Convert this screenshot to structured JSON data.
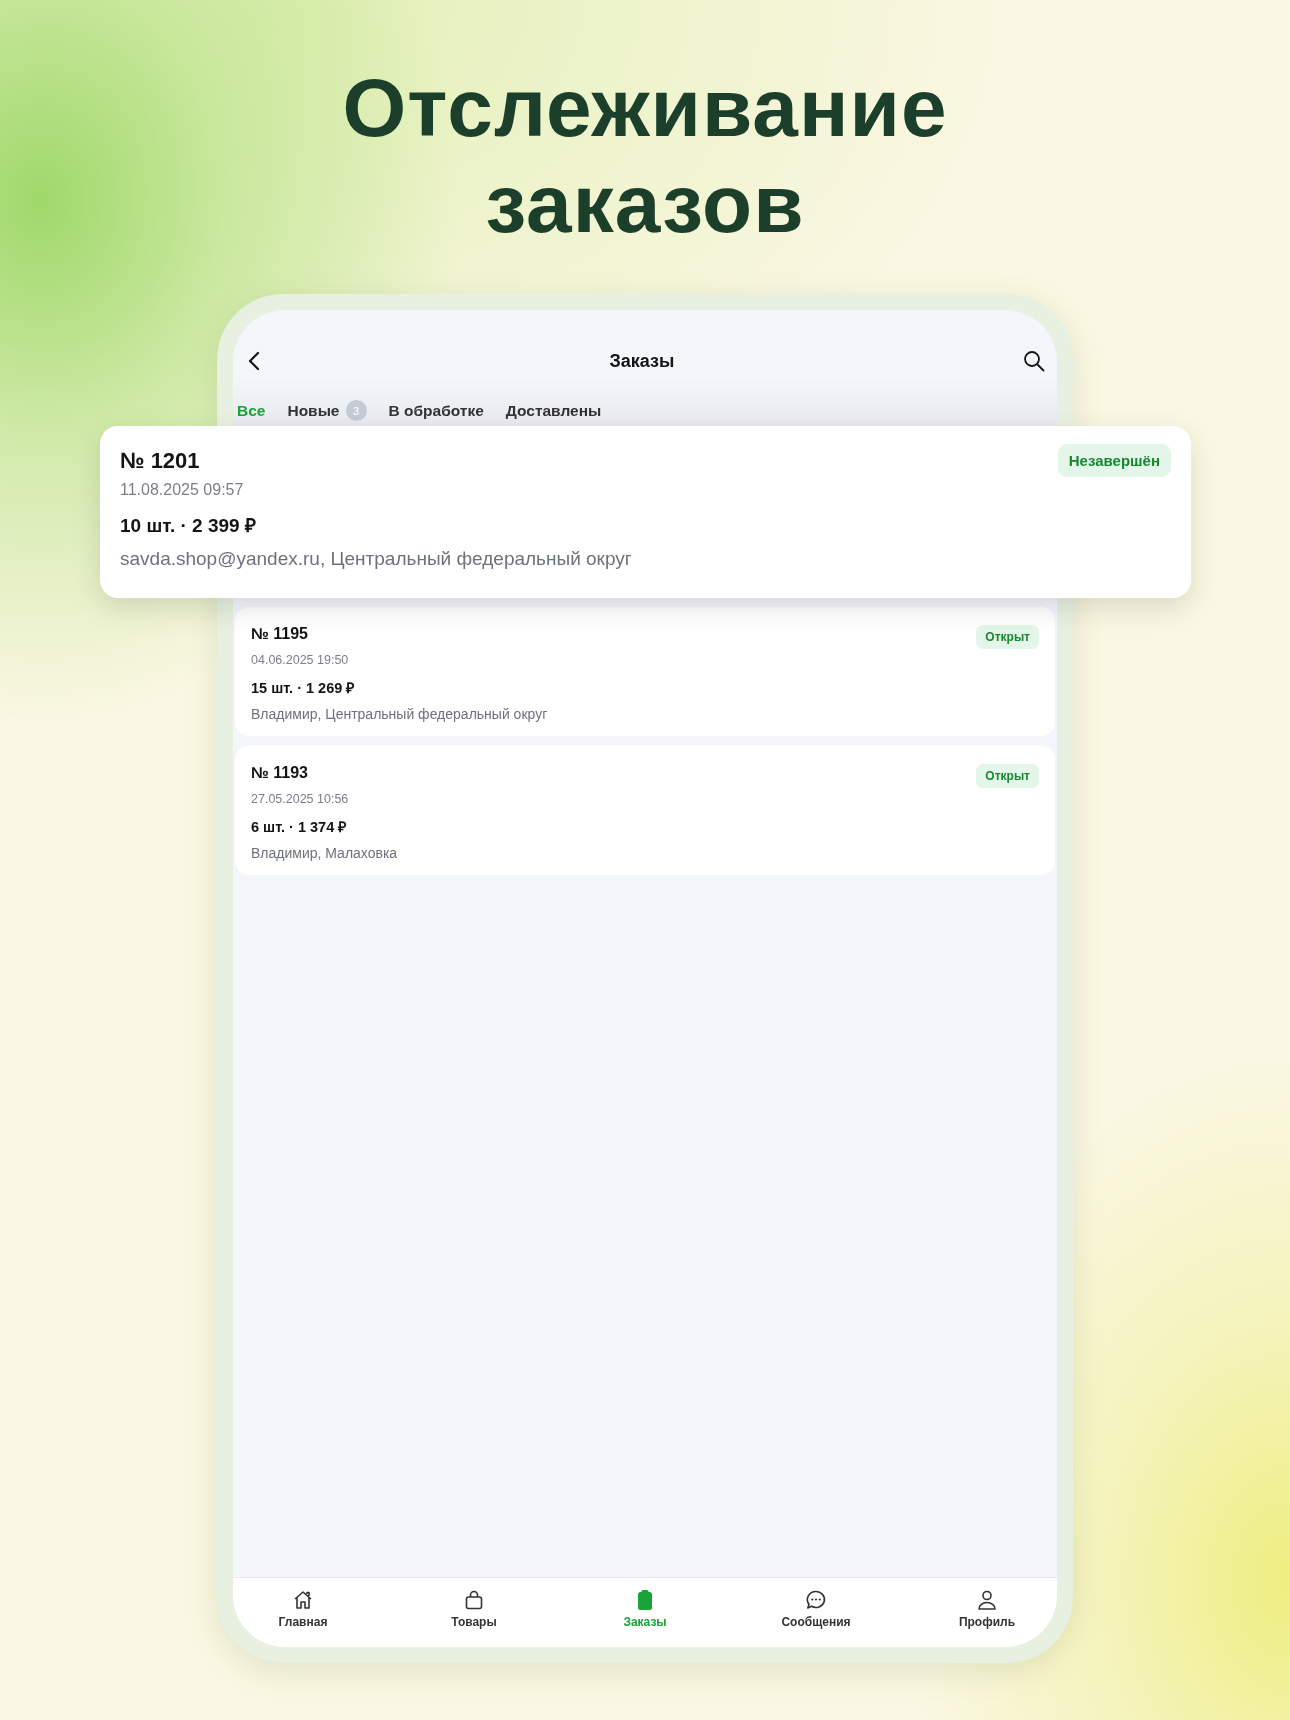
{
  "headline": "Отслеживание заказов",
  "top_bar": {
    "title": "Заказы"
  },
  "tabs": [
    {
      "label": "Все",
      "selected": true
    },
    {
      "label": "Новые",
      "badge": "3",
      "selected": false
    },
    {
      "label": "В обработке",
      "selected": false
    },
    {
      "label": "Доставлены",
      "selected": false
    }
  ],
  "highlighted_order": {
    "number": "№ 1201",
    "status": "Незавершён",
    "date": "11.08.2025 09:57",
    "summary": "10 шт. · 2 399 ₽",
    "details": "savda.shop@yandex.ru, Центральный федеральный округ"
  },
  "orders": [
    {
      "number": "№ 1195",
      "status": "Открыт",
      "date": "04.06.2025 19:50",
      "summary": "15 шт. · 1 269 ₽",
      "details": "Владимир, Центральный федеральный округ"
    },
    {
      "number": "№ 1193",
      "status": "Открыт",
      "date": "27.05.2025 10:56",
      "summary": "6 шт. · 1 374 ₽",
      "details": "Владимир, Малаховка"
    }
  ],
  "nav": [
    {
      "label": "Главная",
      "kind": "home",
      "selected": false
    },
    {
      "label": "Товары",
      "kind": "bag",
      "selected": false
    },
    {
      "label": "Заказы",
      "kind": "clipboard",
      "selected": true
    },
    {
      "label": "Сообщения",
      "kind": "chat",
      "selected": false
    },
    {
      "label": "Профиль",
      "kind": "person",
      "selected": false
    }
  ]
}
